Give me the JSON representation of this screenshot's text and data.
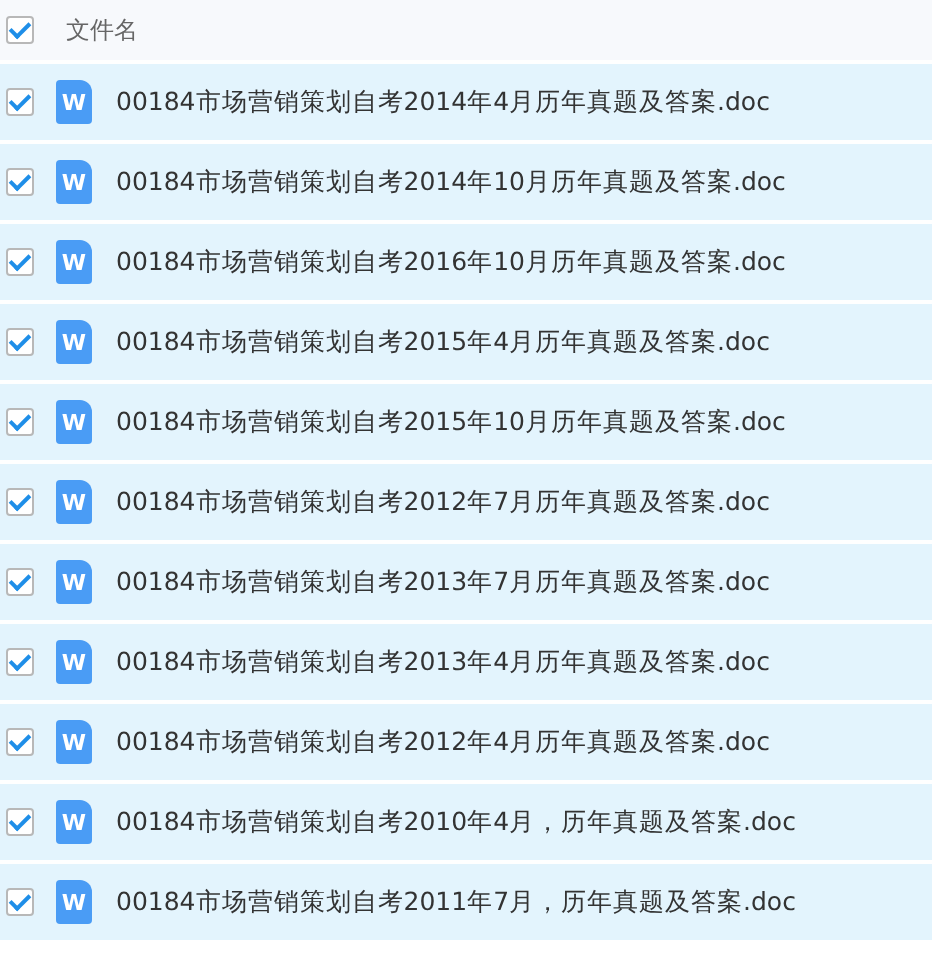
{
  "header": {
    "checked": true,
    "label": "文件名"
  },
  "rows": [
    {
      "checked": true,
      "icon_label": "W",
      "name": "00184市场营销策划自考2014年4月历年真题及答案.doc"
    },
    {
      "checked": true,
      "icon_label": "W",
      "name": "00184市场营销策划自考2014年10月历年真题及答案.doc"
    },
    {
      "checked": true,
      "icon_label": "W",
      "name": "00184市场营销策划自考2016年10月历年真题及答案.doc"
    },
    {
      "checked": true,
      "icon_label": "W",
      "name": "00184市场营销策划自考2015年4月历年真题及答案.doc"
    },
    {
      "checked": true,
      "icon_label": "W",
      "name": "00184市场营销策划自考2015年10月历年真题及答案.doc"
    },
    {
      "checked": true,
      "icon_label": "W",
      "name": "00184市场营销策划自考2012年7月历年真题及答案.doc"
    },
    {
      "checked": true,
      "icon_label": "W",
      "name": "00184市场营销策划自考2013年7月历年真题及答案.doc"
    },
    {
      "checked": true,
      "icon_label": "W",
      "name": "00184市场营销策划自考2013年4月历年真题及答案.doc"
    },
    {
      "checked": true,
      "icon_label": "W",
      "name": "00184市场营销策划自考2012年4月历年真题及答案.doc"
    },
    {
      "checked": true,
      "icon_label": "W",
      "name": "00184市场营销策划自考2010年4月，历年真题及答案.doc"
    },
    {
      "checked": true,
      "icon_label": "W",
      "name": "00184市场营销策划自考2011年7月，历年真题及答案.doc"
    }
  ]
}
